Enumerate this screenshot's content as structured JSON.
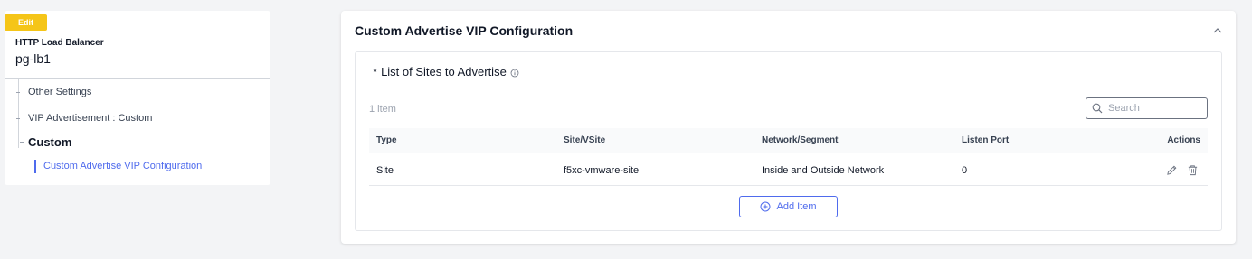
{
  "left": {
    "badge": "Edit",
    "lb_type": "HTTP Load Balancer",
    "lb_name": "pg-lb1",
    "nav": [
      {
        "label": "Other Settings"
      },
      {
        "label": "VIP Advertisement : Custom"
      },
      {
        "label": "Custom"
      },
      {
        "label": "Custom Advertise VIP Configuration"
      }
    ]
  },
  "card": {
    "title": "Custom Advertise VIP Configuration",
    "section_required_mark": "*",
    "section_label": "List of Sites to Advertise",
    "item_count": "1 item",
    "search_placeholder": "Search",
    "columns": [
      "Type",
      "Site/VSite",
      "Network/Segment",
      "Listen Port",
      "Actions"
    ],
    "rows": [
      {
        "type": "Site",
        "site": "f5xc-vmware-site",
        "network": "Inside and Outside Network",
        "port": "0"
      }
    ],
    "add_label": "Add Item"
  },
  "colors": {
    "accent": "#4f6bed",
    "badge": "#f5c518"
  },
  "icons": [
    "chevron-up-icon",
    "info-icon",
    "search-icon",
    "edit-icon",
    "trash-icon",
    "plus-circle-icon"
  ]
}
